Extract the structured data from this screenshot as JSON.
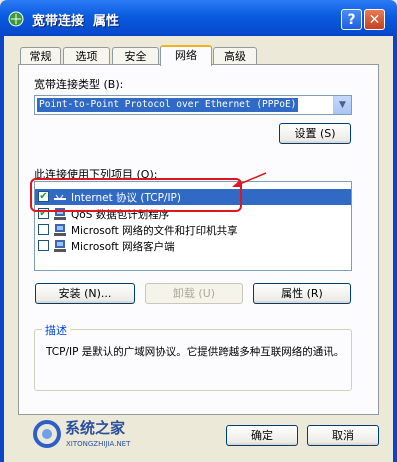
{
  "window": {
    "title": "宽带连接  属性",
    "help_label": "?",
    "close_label": "✕"
  },
  "tabs": [
    {
      "label": "常规",
      "active": false
    },
    {
      "label": "选项",
      "active": false
    },
    {
      "label": "安全",
      "active": false
    },
    {
      "label": "网络",
      "active": true
    },
    {
      "label": "高级",
      "active": false
    }
  ],
  "network": {
    "connection_type_label": "宽带连接类型 (B):",
    "connection_type_value": "Point-to-Point Protocol over Ethernet (PPPoE)",
    "settings_button": "设置 (S)",
    "items_label": "此连接使用下列项目 (O):",
    "items": [
      {
        "label": "Internet 协议 (TCP/IP)",
        "checked": true,
        "selected": true,
        "icon": "network-protocol-icon"
      },
      {
        "label": "QoS 数据包计划程序",
        "checked": true,
        "selected": false,
        "icon": "network-service-icon"
      },
      {
        "label": "Microsoft 网络的文件和打印机共享",
        "checked": false,
        "selected": false,
        "icon": "network-service-icon"
      },
      {
        "label": "Microsoft 网络客户端",
        "checked": false,
        "selected": false,
        "icon": "network-client-icon"
      }
    ],
    "install_button": "安装 (N)...",
    "uninstall_button": "卸载 (U)",
    "properties_button": "属性 (R)",
    "description_title": "描述",
    "description_text": "TCP/IP 是默认的广域网协议。它提供跨越多种互联网络的通讯。"
  },
  "footer": {
    "ok_button": "确定",
    "cancel_button": "取消"
  },
  "watermark": {
    "name": "系统之家",
    "url": "XITONGZHIJIA.NET"
  },
  "colors": {
    "title_bar": "#0A5BE0",
    "selection": "#316AC5",
    "annotation": "#E0161E",
    "group_title": "#0046D5"
  }
}
